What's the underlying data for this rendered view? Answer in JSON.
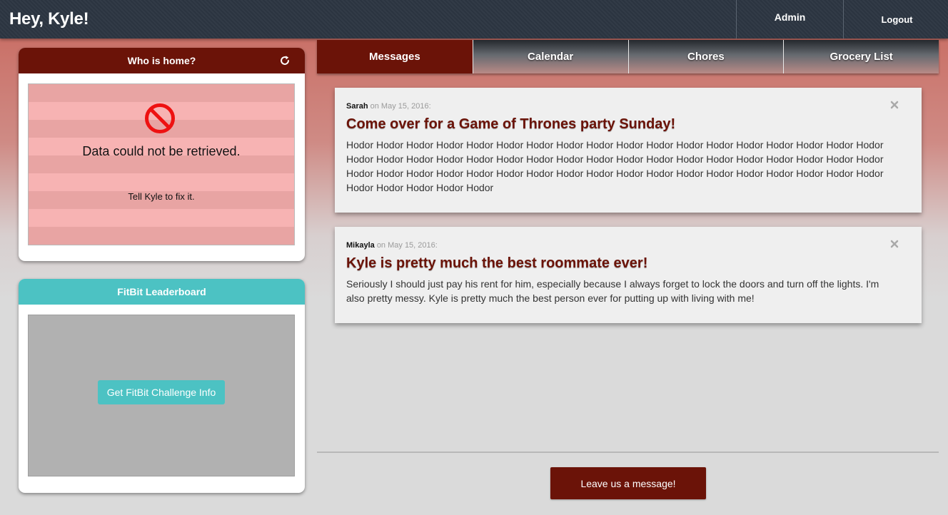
{
  "header": {
    "greeting": "Hey, Kyle!",
    "nav": [
      "Admin",
      "Logout"
    ]
  },
  "who_home": {
    "title": "Who is home?",
    "refresh_icon": "refresh-icon",
    "error_icon": "no-entry-icon",
    "error_title": "Data could not be retrieved.",
    "error_sub": "Tell Kyle to fix it."
  },
  "fitbit": {
    "title": "FitBit Leaderboard",
    "button": "Get FitBit Challenge Info"
  },
  "tabs": [
    {
      "label": "Messages",
      "active": true
    },
    {
      "label": "Calendar",
      "active": false
    },
    {
      "label": "Chores",
      "active": false
    },
    {
      "label": "Grocery List",
      "active": false
    }
  ],
  "messages": [
    {
      "author": "Sarah",
      "date": "on May 15, 2016:",
      "title": "Come over for a Game of Thrones party Sunday!",
      "body": "Hodor Hodor Hodor Hodor Hodor Hodor Hodor Hodor Hodor Hodor Hodor Hodor Hodor Hodor Hodor Hodor Hodor Hodor Hodor Hodor Hodor Hodor Hodor Hodor Hodor Hodor Hodor Hodor Hodor Hodor Hodor Hodor Hodor Hodor Hodor Hodor Hodor Hodor Hodor Hodor Hodor Hodor Hodor Hodor Hodor Hodor Hodor Hodor Hodor Hodor Hodor Hodor Hodor Hodor Hodor Hodor Hodor Hodor Hodor"
    },
    {
      "author": "Mikayla",
      "date": "on May 15, 2016:",
      "title": "Kyle is pretty much the best roommate ever!",
      "body": "Seriously I should just pay his rent for him, especially because I always forget to lock the doors and turn off the lights. I'm also pretty messy. Kyle is pretty much the best person ever for putting up with living with me!"
    }
  ],
  "leave_message_button": "Leave us a message!",
  "colors": {
    "brand_red": "#6b1308",
    "teal": "#4cc2c3",
    "topbar": "#2b3440"
  }
}
